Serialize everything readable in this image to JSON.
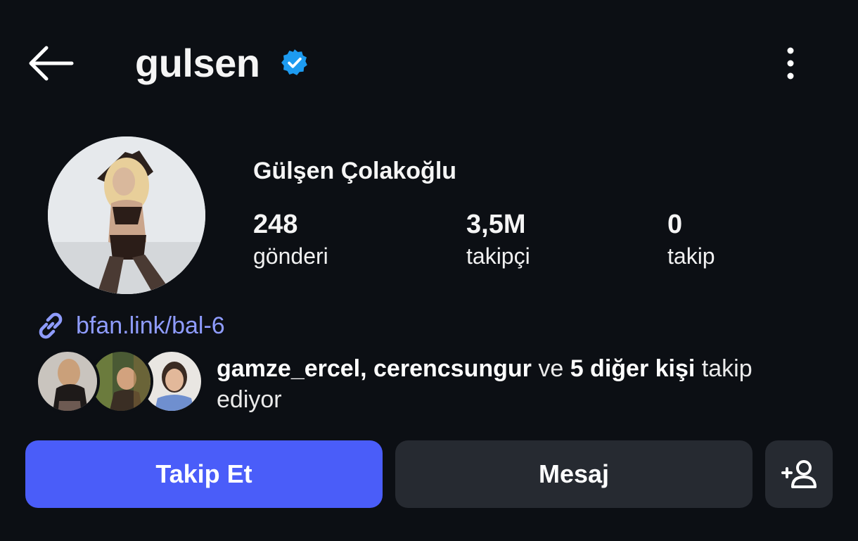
{
  "header": {
    "username": "gulsen",
    "verified_icon": "verified-badge-icon",
    "verified_color": "#1d9bf0",
    "back_icon": "arrow-left-icon",
    "more_icon": "more-vertical-icon"
  },
  "profile": {
    "full_name": "Gülşen Çolakoğlu",
    "stats": [
      {
        "value": "248",
        "label": "gönderi"
      },
      {
        "value": "3,5M",
        "label": "takipçi"
      },
      {
        "value": "0",
        "label": "takip"
      }
    ],
    "link": {
      "icon": "link-icon",
      "text": "bfan.link/bal-6",
      "color": "#8f9cff"
    }
  },
  "mutual_followers": {
    "names": "gamze_ercel, cerencsungur",
    "connector": " ve ",
    "others": "5 diğer kişi",
    "suffix": " takip ediyor"
  },
  "actions": {
    "follow_label": "Takip Et",
    "message_label": "Mesaj",
    "add_user_icon": "add-user-icon",
    "accent": "#4a5df9",
    "secondary": "#262a31"
  }
}
